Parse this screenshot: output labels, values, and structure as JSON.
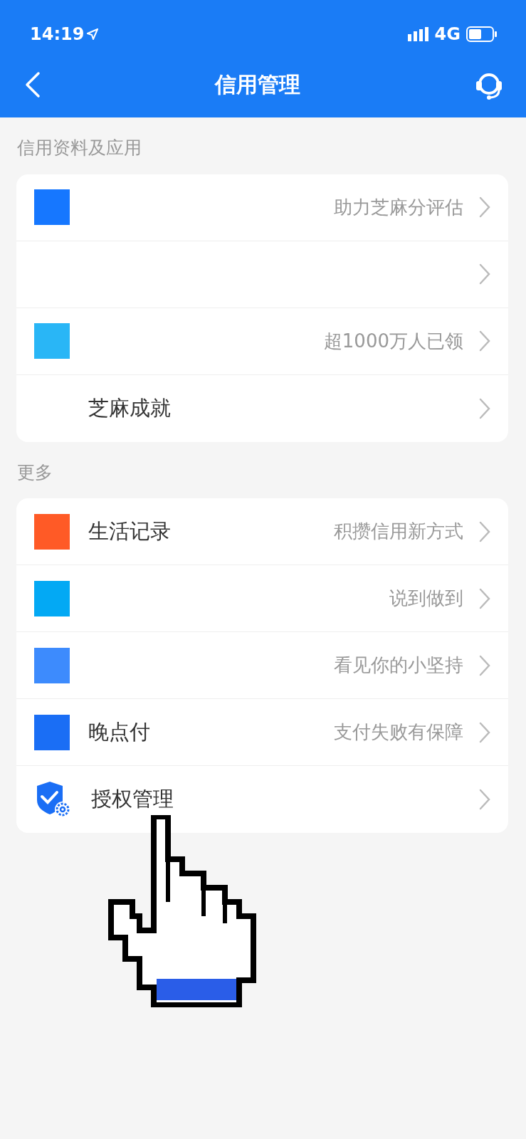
{
  "status_bar": {
    "time": "14:19",
    "network": "4G"
  },
  "nav": {
    "title": "信用管理"
  },
  "sections": [
    {
      "header": "信用资料及应用",
      "rows": [
        {
          "kind": "square",
          "color": "#1677ff",
          "subtitle": "助力芝麻分评估"
        },
        {
          "kind": "blank"
        },
        {
          "kind": "square",
          "color": "#29b6f6",
          "subtitle": "超1000万人已领"
        },
        {
          "kind": "blank",
          "title": "芝麻成就"
        }
      ]
    },
    {
      "header": "更多",
      "rows": [
        {
          "kind": "square",
          "color": "#ff5a26",
          "title": "生活记录",
          "subtitle": "积攒信用新方式"
        },
        {
          "kind": "square",
          "color": "#03a9f4",
          "subtitle": "说到做到"
        },
        {
          "kind": "square",
          "color": "#3d8bfd",
          "subtitle": "看见你的小坚持"
        },
        {
          "kind": "square",
          "color": "#1a6ef5",
          "title": "晚点付",
          "subtitle": "支付失败有保障"
        },
        {
          "kind": "shield",
          "color": "#1a6ef5",
          "title": "授权管理"
        }
      ]
    }
  ]
}
